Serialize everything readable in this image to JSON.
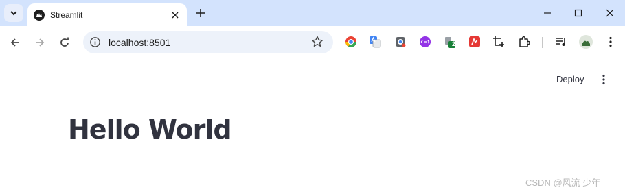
{
  "browser": {
    "tab": {
      "title": "Streamlit"
    },
    "address_bar": {
      "url": "localhost:8501"
    },
    "extension_badge": "2"
  },
  "app": {
    "header": {
      "deploy_label": "Deploy"
    },
    "main": {
      "heading": "Hello World"
    }
  },
  "watermark": "CSDN @风流 少年"
}
